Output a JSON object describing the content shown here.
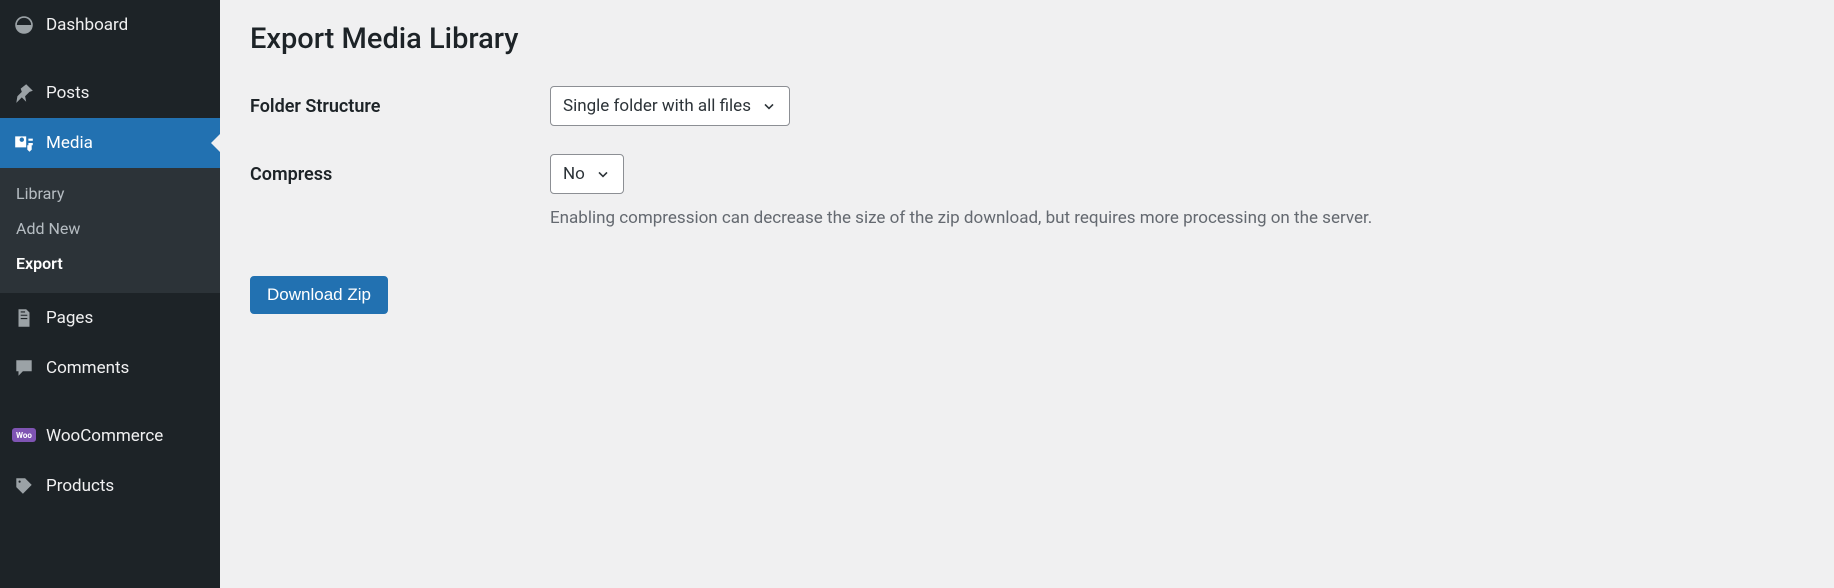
{
  "sidebar": {
    "items": [
      {
        "label": "Dashboard"
      },
      {
        "label": "Posts"
      },
      {
        "label": "Media"
      },
      {
        "label": "Pages"
      },
      {
        "label": "Comments"
      },
      {
        "label": "WooCommerce"
      },
      {
        "label": "Products"
      }
    ],
    "media_submenu": {
      "library": "Library",
      "add_new": "Add New",
      "export": "Export"
    }
  },
  "page": {
    "title": "Export Media Library",
    "folder_structure_label": "Folder Structure",
    "folder_structure_value": "Single folder with all files",
    "compress_label": "Compress",
    "compress_value": "No",
    "compress_description": "Enabling compression can decrease the size of the zip download, but requires more processing on the server.",
    "download_button": "Download Zip"
  }
}
